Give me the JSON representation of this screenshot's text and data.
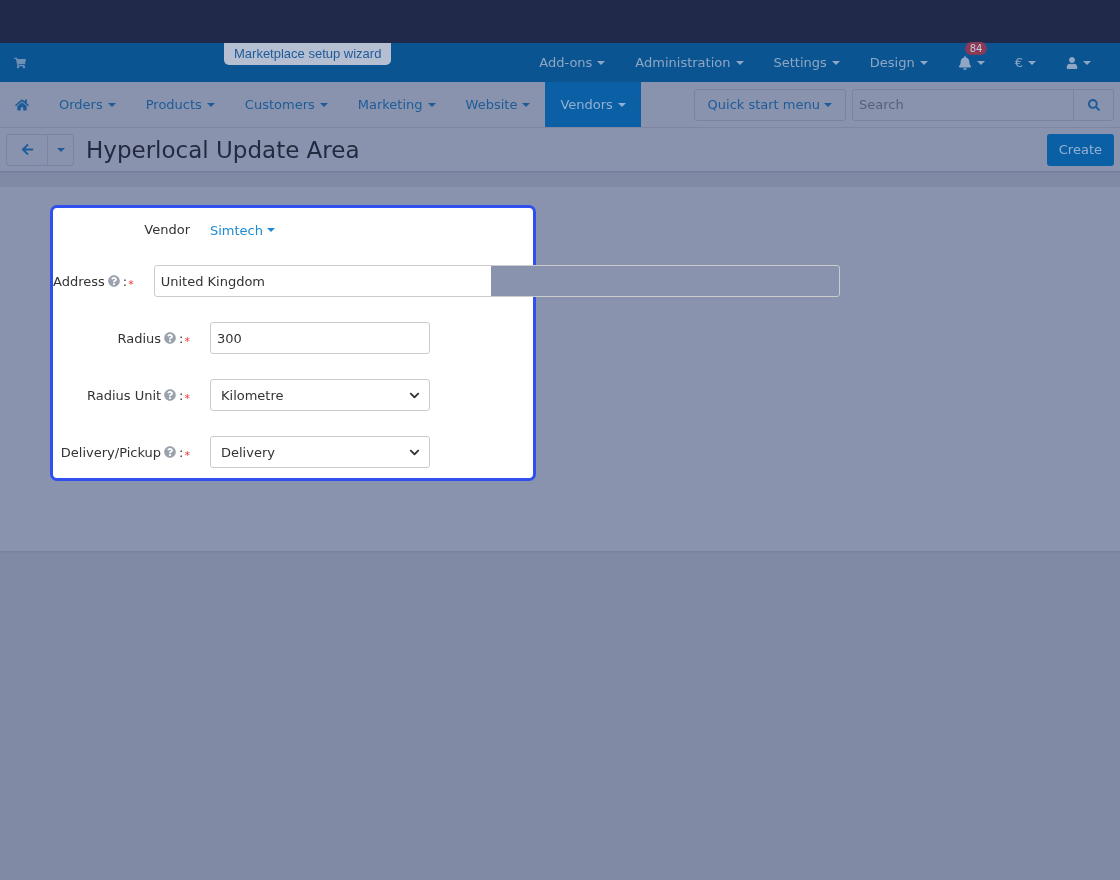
{
  "top_bar": {
    "wizard_button": "Marketplace setup wizard",
    "menus": [
      {
        "label": "Add-ons"
      },
      {
        "label": "Administration"
      },
      {
        "label": "Settings"
      },
      {
        "label": "Design"
      }
    ],
    "notifications": {
      "count": "84"
    },
    "currency": "€"
  },
  "main_nav": {
    "items": [
      {
        "label": "Orders",
        "selected": false
      },
      {
        "label": "Products",
        "selected": false
      },
      {
        "label": "Customers",
        "selected": false
      },
      {
        "label": "Marketing",
        "selected": false
      },
      {
        "label": "Website",
        "selected": false
      },
      {
        "label": "Vendors",
        "selected": true
      }
    ],
    "quick_start_menu": "Quick start menu",
    "search": {
      "placeholder": "Search"
    }
  },
  "page_header": {
    "title": "Hyperlocal Update Area",
    "create_button": "Create"
  },
  "form": {
    "vendor": {
      "label": "Vendor",
      "value": "Simtech"
    },
    "fields": [
      {
        "kind": "text",
        "label": "Address",
        "colon": ":",
        "required_mark": "*",
        "value": "United Kingdom",
        "wide": true
      },
      {
        "kind": "text",
        "label": "Radius",
        "colon": ":",
        "required_mark": "*",
        "value": "300",
        "wide": false
      },
      {
        "kind": "select",
        "label": "Radius Unit",
        "colon": ":",
        "required_mark": "*",
        "value": "Kilometre"
      },
      {
        "kind": "select",
        "label": "Delivery/Pickup",
        "colon": ":",
        "required_mark": "*",
        "value": "Delivery"
      }
    ]
  }
}
